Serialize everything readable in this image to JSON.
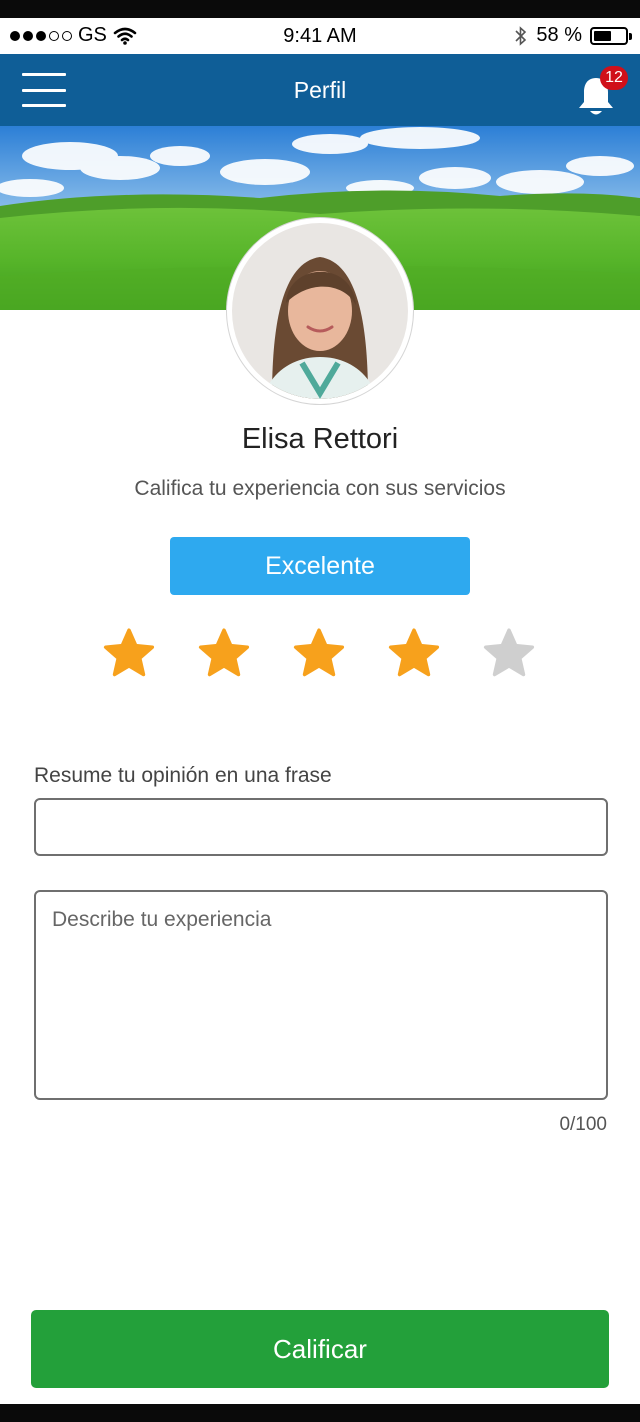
{
  "status_bar": {
    "carrier": "GS",
    "time": "9:41 AM",
    "battery": "58 %",
    "battery_level": 0.58,
    "icons": [
      "signal-dots",
      "wifi-icon",
      "bluetooth-icon",
      "battery-icon"
    ]
  },
  "header": {
    "title": "Perfil",
    "notification_count": "12",
    "icons": [
      "menu-icon",
      "bell-icon"
    ]
  },
  "profile": {
    "name": "Elisa Rettori",
    "prompt": "Califica tu experiencia con sus servicios"
  },
  "rating": {
    "label": "Excelente",
    "value": 4,
    "max": 5,
    "colors": {
      "filled": "#f7a11c",
      "empty": "#cfcfcf"
    }
  },
  "form": {
    "opinion_label": "Resume tu opinión en una frase",
    "opinion_value": "",
    "experience_placeholder": "Describe tu experiencia",
    "experience_value": "",
    "char_count": "0/100"
  },
  "actions": {
    "submit_label": "Calificar"
  },
  "colors": {
    "header": "#0f5e97",
    "rating_label": "#2ea9ef",
    "submit": "#23a03a",
    "badge": "#d0101a"
  }
}
